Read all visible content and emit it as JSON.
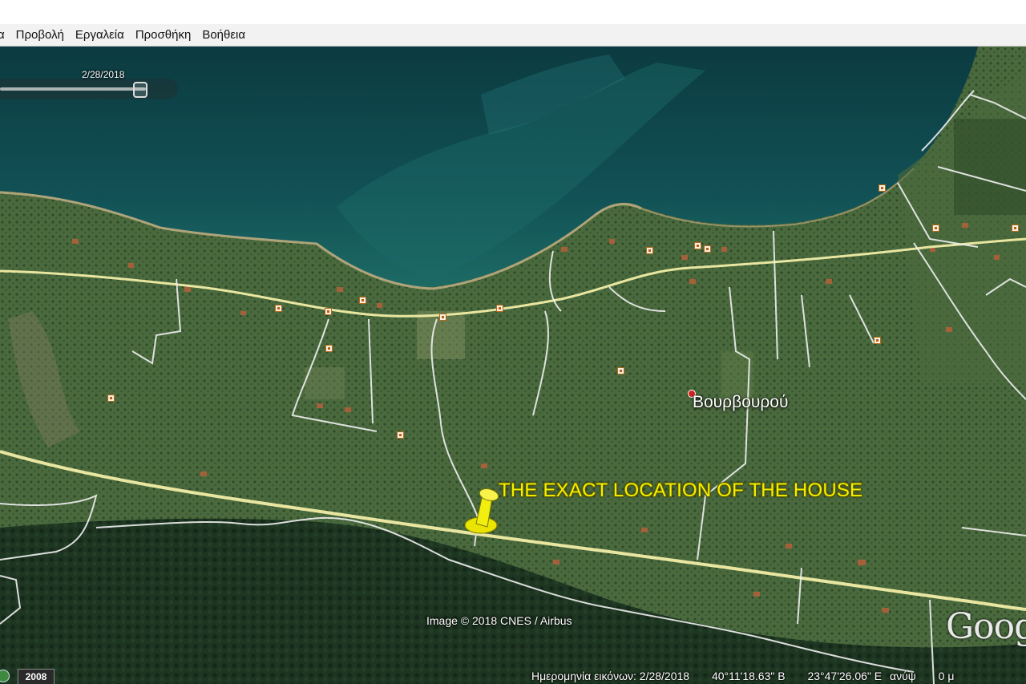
{
  "menu": {
    "items": [
      "α",
      "Προβολή",
      "Εργαλεία",
      "Προσθήκη",
      "Βοήθεια"
    ]
  },
  "time_slider": {
    "date": "2/28/2018"
  },
  "places": {
    "town": "Βουρβουρού",
    "house_label": "THE EXACT LOCATION OF THE HOUSE",
    "pushpin_icon": "yellow-pushpin-icon"
  },
  "attribution": "Image © 2018 CNES / Airbus",
  "logo": "Goog",
  "status": {
    "historical_year": "2008",
    "imagery_date": "Ημερομηνία εικόνων: 2/28/2018",
    "latitude": "40°11'18.63\" Β",
    "longitude": "23°47'26.06\" Ε",
    "elevation": "ανύψ",
    "eye_alt": "0 μ"
  },
  "colors": {
    "sea": "#0f4a4c",
    "land": "#3f6038",
    "forest": "#1f3a22",
    "road_main": "#e8e6a0",
    "label_yellow": "#f4f000"
  }
}
